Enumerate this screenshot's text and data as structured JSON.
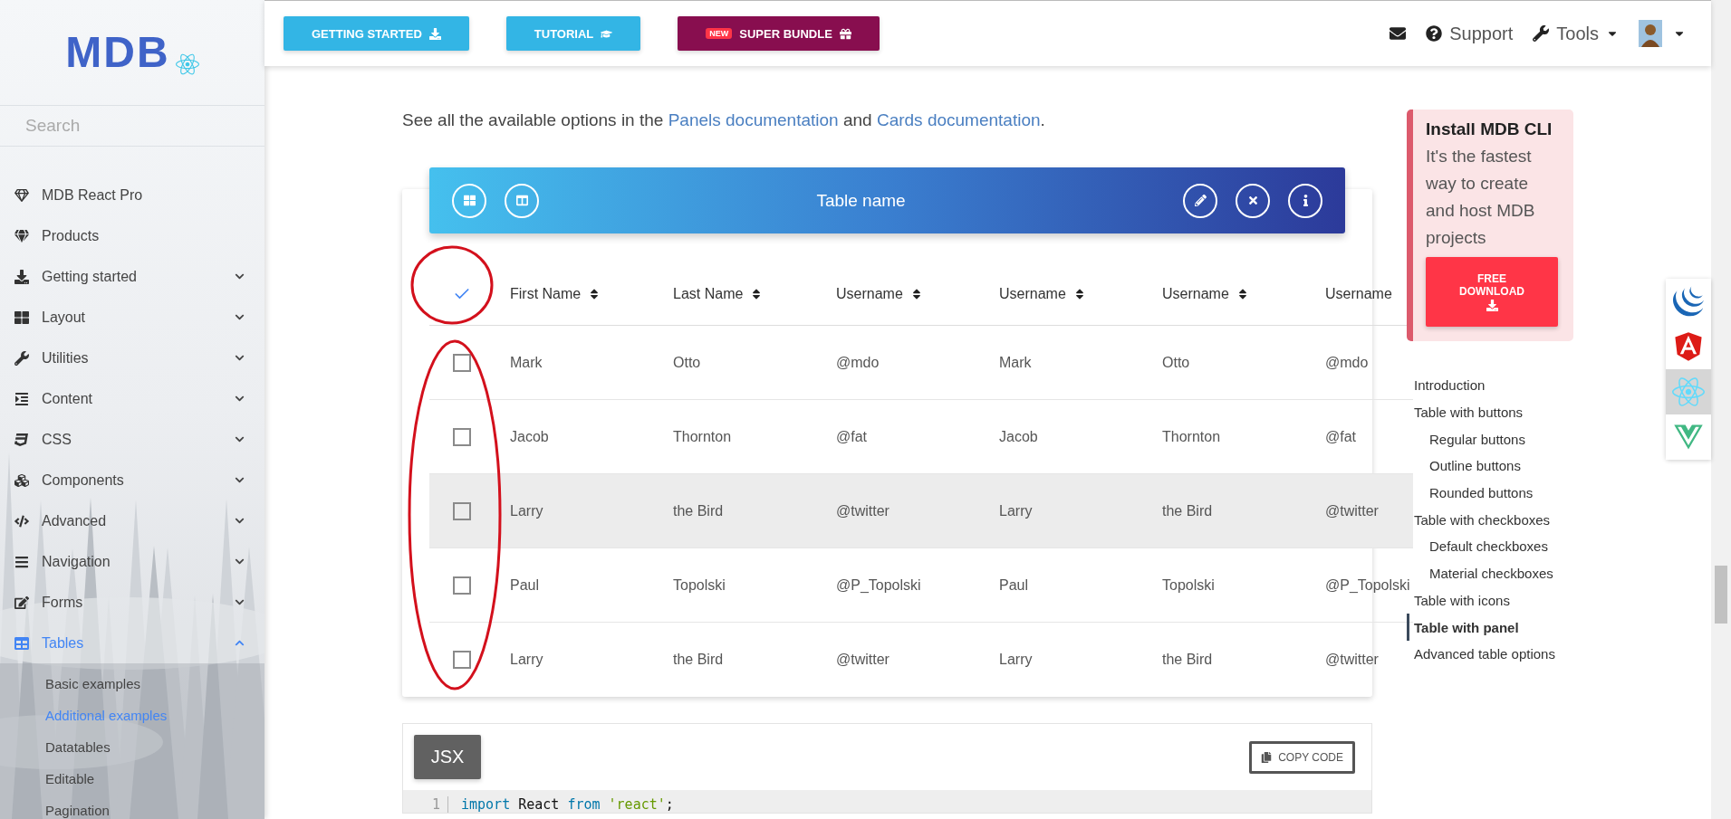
{
  "sidebar": {
    "logo": "MDB",
    "search": {
      "placeholder": "Search"
    },
    "items": [
      {
        "label": "MDB React Pro",
        "kind": "link",
        "selected": false
      },
      {
        "label": "Products",
        "kind": "link",
        "selected": false
      },
      {
        "label": "Getting started",
        "kind": "group",
        "expanded": false,
        "selected": false
      },
      {
        "label": "Layout",
        "kind": "group",
        "expanded": false,
        "selected": false
      },
      {
        "label": "Utilities",
        "kind": "group",
        "expanded": false,
        "selected": false
      },
      {
        "label": "Content",
        "kind": "group",
        "expanded": false,
        "selected": false
      },
      {
        "label": "CSS",
        "kind": "group",
        "expanded": false,
        "selected": false
      },
      {
        "label": "Components",
        "kind": "group",
        "expanded": false,
        "selected": false
      },
      {
        "label": "Advanced",
        "kind": "group",
        "expanded": false,
        "selected": false
      },
      {
        "label": "Navigation",
        "kind": "group",
        "expanded": false,
        "selected": false
      },
      {
        "label": "Forms",
        "kind": "group",
        "expanded": false,
        "selected": false
      },
      {
        "label": "Tables",
        "kind": "group",
        "expanded": true,
        "selected": true,
        "children": [
          {
            "label": "Basic examples",
            "selected": false
          },
          {
            "label": "Additional examples",
            "selected": true
          },
          {
            "label": "Datatables",
            "selected": false
          },
          {
            "label": "Editable",
            "selected": false
          },
          {
            "label": "Pagination",
            "selected": false
          }
        ]
      }
    ]
  },
  "navbar": {
    "buttons": [
      {
        "label": "GETTING STARTED",
        "kind": "info"
      },
      {
        "label": "TUTORIAL",
        "kind": "info"
      },
      {
        "label": "SUPER BUNDLE",
        "kind": "promo",
        "badge": "NEW"
      }
    ],
    "support": "Support",
    "tools": "Tools"
  },
  "intro": {
    "before": "See all the available options in the ",
    "link1": "Panels documentation",
    "middle": " and ",
    "link2": "Cards documentation",
    "after": "."
  },
  "table": {
    "title": "Table name",
    "select_all": {
      "checked": true
    },
    "columns": [
      {
        "label": "First Name",
        "sortable": true
      },
      {
        "label": "Last Name",
        "sortable": true
      },
      {
        "label": "Username",
        "sortable": true
      },
      {
        "label": "Username",
        "sortable": true
      },
      {
        "label": "Username",
        "sortable": true
      },
      {
        "label": "Username",
        "sortable": false
      }
    ],
    "rows": [
      {
        "checked": false,
        "highlighted": false,
        "cells": [
          "Mark",
          "Otto",
          "@mdo",
          "Mark",
          "Otto",
          "@mdo"
        ]
      },
      {
        "checked": false,
        "highlighted": false,
        "cells": [
          "Jacob",
          "Thornton",
          "@fat",
          "Jacob",
          "Thornton",
          "@fat"
        ]
      },
      {
        "checked": false,
        "highlighted": true,
        "cells": [
          "Larry",
          "the Bird",
          "@twitter",
          "Larry",
          "the Bird",
          "@twitter"
        ]
      },
      {
        "checked": false,
        "highlighted": false,
        "cells": [
          "Paul",
          "Topolski",
          "@P_Topolski",
          "Paul",
          "Topolski",
          "@P_Topolski"
        ]
      },
      {
        "checked": false,
        "highlighted": false,
        "cells": [
          "Larry",
          "the Bird",
          "@twitter",
          "Larry",
          "the Bird",
          "@twitter"
        ]
      }
    ]
  },
  "cli": {
    "title": "Install MDB CLI",
    "text": "It's the fastest way to create and host MDB projects",
    "button": "FREE DOWNLOAD"
  },
  "toc": [
    {
      "label": "Introduction",
      "selected": false
    },
    {
      "label": "Table with buttons",
      "selected": false,
      "children": [
        {
          "label": "Regular buttons",
          "selected": false
        },
        {
          "label": "Outline buttons",
          "selected": false
        },
        {
          "label": "Rounded buttons",
          "selected": false
        }
      ]
    },
    {
      "label": "Table with checkboxes",
      "selected": false,
      "children": [
        {
          "label": "Default checkboxes",
          "selected": false
        },
        {
          "label": "Material checkboxes",
          "selected": false
        }
      ]
    },
    {
      "label": "Table with icons",
      "selected": false
    },
    {
      "label": "Table with panel",
      "selected": true
    },
    {
      "label": "Advanced table options",
      "selected": false
    }
  ],
  "frameworks": [
    {
      "kind": "jquery",
      "selected": false
    },
    {
      "kind": "angular",
      "selected": false
    },
    {
      "kind": "react",
      "selected": true
    },
    {
      "kind": "vue",
      "selected": false
    }
  ],
  "code": {
    "tab": "JSX",
    "copy": "COPY CODE",
    "lines": [
      {
        "number": "1",
        "tokens": [
          {
            "text": "import",
            "kind": "keyword"
          },
          {
            "text": " React ",
            "kind": "plain"
          },
          {
            "text": "from ",
            "kind": "keyword"
          },
          {
            "text": "'react'",
            "kind": "string"
          },
          {
            "text": ";",
            "kind": "plain"
          }
        ]
      }
    ]
  }
}
